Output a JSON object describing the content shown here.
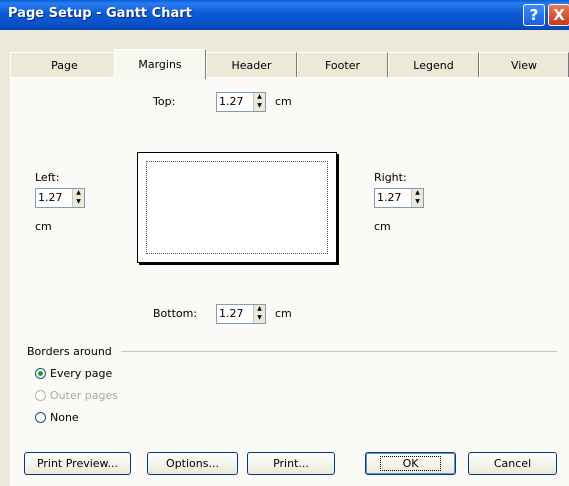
{
  "window": {
    "title": "Page Setup - Gantt Chart"
  },
  "titlebar": {
    "help_glyph": "?",
    "close_glyph": "X"
  },
  "tabs": [
    {
      "label": "Page",
      "active": false
    },
    {
      "label": "Margins",
      "active": true
    },
    {
      "label": "Header",
      "active": false
    },
    {
      "label": "Footer",
      "active": false
    },
    {
      "label": "Legend",
      "active": false
    },
    {
      "label": "View",
      "active": false
    }
  ],
  "margins": {
    "top": {
      "label": "Top:",
      "value": "1.27",
      "unit": "cm"
    },
    "left": {
      "label": "Left:",
      "value": "1.27",
      "unit": "cm"
    },
    "right": {
      "label": "Right:",
      "value": "1.27",
      "unit": "cm"
    },
    "bottom": {
      "label": "Bottom:",
      "value": "1.27",
      "unit": "cm"
    }
  },
  "borders": {
    "group_label": "Borders around",
    "options": [
      {
        "label": "Every page",
        "checked": true,
        "enabled": true
      },
      {
        "label": "Outer pages",
        "checked": false,
        "enabled": false
      },
      {
        "label": "None",
        "checked": false,
        "enabled": true
      }
    ]
  },
  "buttons": {
    "print_preview": "Print Preview...",
    "options": "Options...",
    "print": "Print...",
    "ok": "OK",
    "cancel": "Cancel"
  },
  "colors": {
    "titlebar": "#0a52c8",
    "dialog_bg": "#ece9d8",
    "panel_bg": "#fbfaf6",
    "radio_dot": "#21a121"
  }
}
